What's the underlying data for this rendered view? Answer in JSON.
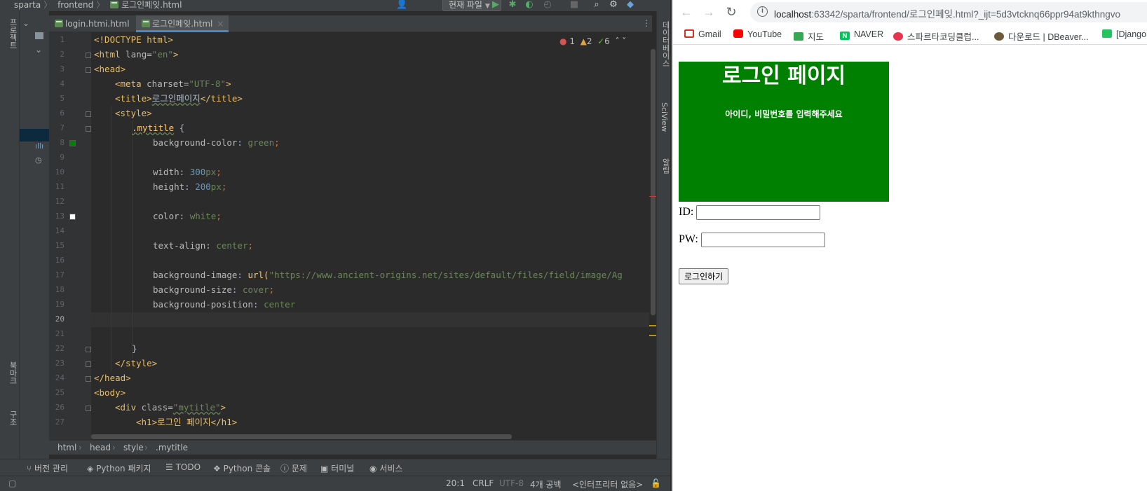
{
  "ide": {
    "nav_crumbs": [
      "sparta",
      "frontend",
      "로그인페잊.html"
    ],
    "run_config": "현재 파일",
    "tabs": [
      {
        "label": "login.htmi.html",
        "active": false
      },
      {
        "label": "로그인페잊.html",
        "active": true
      }
    ],
    "inspections": {
      "errors": "1",
      "warnings": "2",
      "typos": "6"
    },
    "left_tool_labels": [
      "프로젝트",
      "북마크",
      "구조"
    ],
    "right_tool_labels": [
      "데이터베이스",
      "SciView",
      "알림"
    ],
    "line_numbers": [
      "1",
      "2",
      "3",
      "4",
      "5",
      "6",
      "7",
      "8",
      "9",
      "10",
      "11",
      "12",
      "13",
      "14",
      "15",
      "16",
      "17",
      "18",
      "19",
      "20",
      "21",
      "22",
      "23",
      "24",
      "25",
      "26",
      "27"
    ],
    "code": {
      "l1": "<!DOCTYPE html>",
      "l2_tag": "<html ",
      "l2_attr": "lang=",
      "l2_val": "\"en\"",
      "l2_end": ">",
      "l3": "<head>",
      "l4_tag": "<meta ",
      "l4_attr": "charset=",
      "l4_val": "\"UTF-8\"",
      "l4_end": ">",
      "l5_open": "<title>",
      "l5_text": "로그인페이지",
      "l5_close": "</title>",
      "l6": "<style>",
      "l7_sel": ".mytitle",
      "l7_brace": " {",
      "l8_prop": "background-color",
      "l8_colon": ": ",
      "l8_val": "green",
      "l8_semi": ";",
      "l10_prop": "width",
      "l10_colon": ": ",
      "l10_num": "300",
      "l10_unit": "px",
      "l10_semi": ";",
      "l11_prop": "height",
      "l11_colon": ": ",
      "l11_num": "200",
      "l11_unit": "px",
      "l11_semi": ";",
      "l13_prop": "color",
      "l13_colon": ": ",
      "l13_val": "white",
      "l13_semi": ";",
      "l15_prop": "text-align",
      "l15_colon": ": ",
      "l15_val": "center",
      "l15_semi": ";",
      "l17_prop": "background-image",
      "l17_colon": ": ",
      "l17_fn": "url(",
      "l17_url": "\"https://www.ancient-origins.net/sites/default/files/field/image/Ag",
      "l18_prop": "background-size",
      "l18_colon": ": ",
      "l18_val": "cover",
      "l18_semi": ";",
      "l19_prop": "background-position",
      "l19_colon": ": ",
      "l19_val": "center",
      "l22": "}",
      "l23": "</style>",
      "l24": "</head>",
      "l25": "<body>",
      "l26_tag": "<div ",
      "l26_attr": "class=",
      "l26_val": "\"mytitle\"",
      "l26_end": ">",
      "l27": "<h1>로그인 페이지</h1>"
    },
    "breadcrumbs": [
      "html",
      "head",
      "style",
      ".mytitle"
    ],
    "tool_windows": [
      "버전 관리",
      "Python 패키지",
      "TODO",
      "Python 콘솔",
      "문제",
      "터미널",
      "서비스"
    ],
    "status": {
      "position": "20:1",
      "line_sep": "CRLF",
      "encoding": "UTF-8",
      "indent": "4개 공백",
      "interpreter": "<인터프리터 없음>"
    }
  },
  "browser": {
    "url_host": "localhost",
    "url_rest": ":63342/sparta/frontend/로그인페잊.html?_ijt=5d3vtcknq66ppr94at9kthngvo",
    "bookmarks": [
      "Gmail",
      "YouTube",
      "지도",
      "NAVER",
      "스파르타코딩클럽...",
      "다운로드 | DBeaver...",
      "[Django"
    ],
    "page": {
      "h1": "로그인 페이지",
      "h5": "아이디, 비밀번호를 입력해주세요",
      "id_label": "ID:",
      "pw_label": "PW:",
      "login_button": "로그인하기"
    }
  }
}
